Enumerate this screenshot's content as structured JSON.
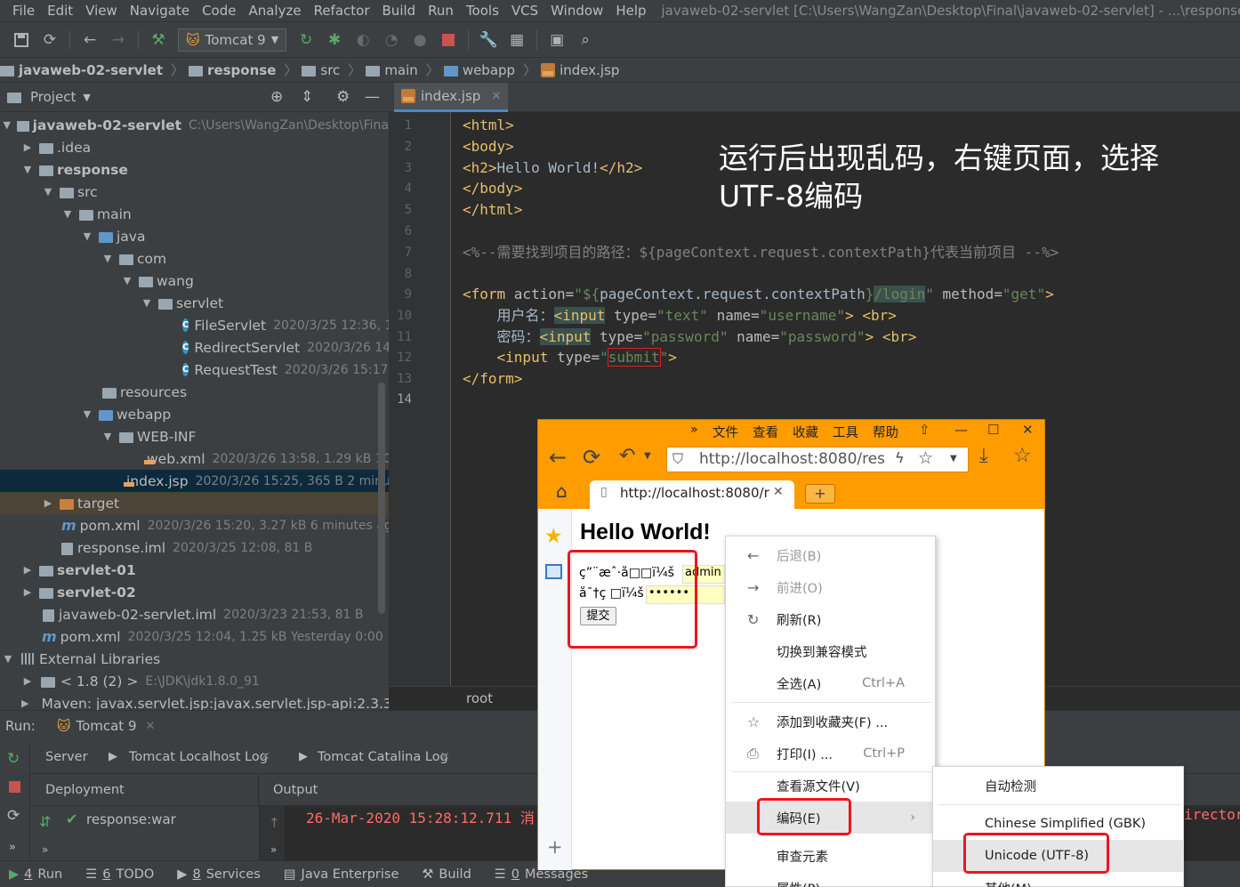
{
  "menubar": {
    "items": [
      "File",
      "Edit",
      "View",
      "Navigate",
      "Code",
      "Analyze",
      "Refactor",
      "Build",
      "Run",
      "Tools",
      "VCS",
      "Window",
      "Help"
    ],
    "window_title": "javaweb-02-servlet [C:\\Users\\WangZan\\Desktop\\Final\\javaweb-02-servlet] - ...\\response"
  },
  "toolbar": {
    "run_config": "Tomcat 9"
  },
  "breadcrumb": [
    "javaweb-02-servlet",
    "response",
    "src",
    "main",
    "webapp",
    "index.jsp"
  ],
  "project_panel": {
    "title": "Project",
    "tree": [
      {
        "name": "javaweb-02-servlet",
        "meta": "C:\\Users\\WangZan\\Desktop\\Fina"
      },
      {
        "name": ".idea",
        "meta": ""
      },
      {
        "name": "response",
        "meta": ""
      },
      {
        "name": "src",
        "meta": ""
      },
      {
        "name": "main",
        "meta": ""
      },
      {
        "name": "java",
        "meta": ""
      },
      {
        "name": "com",
        "meta": ""
      },
      {
        "name": "wang",
        "meta": ""
      },
      {
        "name": "servlet",
        "meta": ""
      },
      {
        "name": "FileServlet",
        "meta": "2020/3/25 12:36, 1."
      },
      {
        "name": "RedirectServlet",
        "meta": "2020/3/26 14"
      },
      {
        "name": "RequestTest",
        "meta": "2020/3/26 15:17,"
      },
      {
        "name": "resources",
        "meta": ""
      },
      {
        "name": "webapp",
        "meta": ""
      },
      {
        "name": "WEB-INF",
        "meta": ""
      },
      {
        "name": "web.xml",
        "meta": "2020/3/26 13:58, 1.29 kB 10"
      },
      {
        "name": "index.jsp",
        "meta": "2020/3/26 15:25, 365 B 2 minut"
      },
      {
        "name": "target",
        "meta": ""
      },
      {
        "name": "pom.xml",
        "meta": "2020/3/26 15:20, 3.27 kB 6 minutes ago"
      },
      {
        "name": "response.iml",
        "meta": "2020/3/25 12:08, 81 B"
      },
      {
        "name": "servlet-01",
        "meta": ""
      },
      {
        "name": "servlet-02",
        "meta": ""
      },
      {
        "name": "javaweb-02-servlet.iml",
        "meta": "2020/3/23 21:53, 81 B"
      },
      {
        "name": "pom.xml",
        "meta": "2020/3/25 12:04, 1.25 kB Yesterday 0:00"
      },
      {
        "name": "External Libraries",
        "meta": ""
      },
      {
        "name": "< 1.8 (2) >",
        "meta": "E:\\JDK\\jdk1.8.0_91"
      },
      {
        "name": "Maven: javax.servlet.jsp:javax.servlet.jsp-api:2.3.3",
        "meta": ""
      }
    ]
  },
  "editor": {
    "tab": "index.jsp",
    "line_numbers": [
      "1",
      "2",
      "3",
      "4",
      "5",
      "6",
      "7",
      "8",
      "9",
      "10",
      "11",
      "12",
      "13",
      "14"
    ],
    "code": {
      "l1": "<html>",
      "l2": "<body>",
      "l3a": "<h2>",
      "l3b": "Hello World!",
      "l3c": "</h2>",
      "l4": "</body>",
      "l5": "</html>",
      "l7": "<%--需要找到项目的路径：${pageContext.request.contextPath}代表当前项目 --%>",
      "l9a": "<form ",
      "l9b": "action=",
      "l9c": "\"${",
      "l9d": "pageContext.request.contextPath",
      "l9e": "}",
      "l9f": "/login",
      "l9g": "\"",
      "l9h": " method=",
      "l9i": "\"get\"",
      "l9j": ">",
      "l10a": "    用户名：",
      "l10b": "<input",
      "l10c": " type=",
      "l10d": "\"text\"",
      "l10e": " name=",
      "l10f": "\"username\"",
      "l10g": "> <br>",
      "l11a": "    密码：",
      "l11b": "<input",
      "l11c": " type=",
      "l11d": "\"password\"",
      "l11e": " name=",
      "l11f": "\"password\"",
      "l11g": "> <br>",
      "l12a": "    <input ",
      "l12b": "type=",
      "l12c": "\"",
      "l12d": "submit",
      "l12e": "\"",
      "l12f": ">",
      "l13": "</form>"
    },
    "overlay_note": "运行后出现乱码，右键页面，选择UTF-8编码",
    "footer_crumb": "root"
  },
  "run_panel": {
    "label": "Run:",
    "config": "Tomcat 9",
    "tabs": [
      "Server",
      "Tomcat Localhost Log",
      "Tomcat Catalina Log"
    ],
    "deployment_header": "Deployment",
    "output_header": "Output",
    "deployment_item": "response:war",
    "log_line": "26-Mar-2020 15:28:12.711 消",
    "log_right": "irector"
  },
  "statusbar": {
    "items": [
      {
        "key": "4",
        "label": "Run"
      },
      {
        "key": "6",
        "label": "TODO"
      },
      {
        "key": "8",
        "label": "Services"
      },
      {
        "key": "",
        "label": "Java Enterprise"
      },
      {
        "key": "",
        "label": "Build"
      },
      {
        "key": "0",
        "label": "Messages"
      }
    ]
  },
  "browser": {
    "menu": [
      "文件",
      "查看",
      "收藏",
      "工具",
      "帮助"
    ],
    "chevron": "»",
    "url": "http://localhost:8080/res",
    "tab_url": "http://localhost:8080/r",
    "new_tab": "+",
    "page": {
      "heading": "Hello World!",
      "garbled_user": "ç”¨æˆ·å□□ï¼š",
      "user_value": "admin",
      "garbled_pass": "å¯†ç □ï¼š",
      "pass_value": "••••••",
      "submit": "提交"
    }
  },
  "context_menu": {
    "items": [
      {
        "label": "后退(B)",
        "shortcut": ""
      },
      {
        "label": "前进(O)",
        "shortcut": ""
      },
      {
        "label": "刷新(R)",
        "shortcut": ""
      },
      {
        "label": "切换到兼容模式",
        "shortcut": ""
      },
      {
        "label": "全选(A)",
        "shortcut": "Ctrl+A"
      },
      {
        "label": "添加到收藏夹(F) ...",
        "shortcut": ""
      },
      {
        "label": "打印(I) ...",
        "shortcut": "Ctrl+P"
      },
      {
        "label": "查看源文件(V)",
        "shortcut": ""
      },
      {
        "label": "编码(E)",
        "shortcut": ""
      },
      {
        "label": "审查元素",
        "shortcut": ""
      },
      {
        "label": "属性(P)",
        "shortcut": ""
      }
    ]
  },
  "encoding_menu": {
    "items": [
      "自动检测",
      "Chinese Simplified (GBK)",
      "Unicode (UTF-8)",
      "其他(M)"
    ]
  },
  "colors": {
    "ide_bg": "#2b2b2b",
    "ide_panel": "#3c3f41",
    "browser_chrome": "#ff9c00",
    "highlight_red": "#f0141e"
  }
}
